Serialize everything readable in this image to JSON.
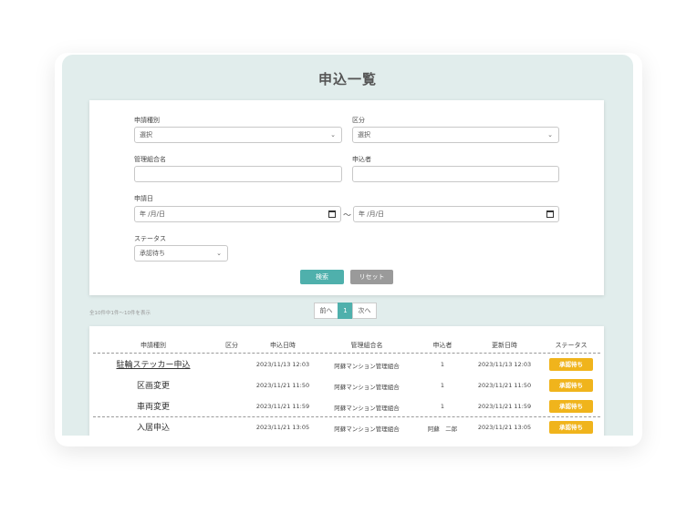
{
  "page": {
    "title": "申込一覧"
  },
  "form": {
    "type_label": "申請種別",
    "type_value": "選択",
    "category_label": "区分",
    "category_value": "選択",
    "association_label": "管理組合名",
    "association_value": "",
    "applicant_label": "申込者",
    "applicant_value": "",
    "date_label": "申請日",
    "date_from_placeholder": "年 /月/日",
    "date_to_placeholder": "年 /月/日",
    "date_separator": "～",
    "status_label": "ステータス",
    "status_value": "承認待ち",
    "search_button": "検索",
    "reset_button": "リセット"
  },
  "list": {
    "count_text": "全10件中1件～10件を表示",
    "pager": {
      "prev": "前へ",
      "current": "1",
      "next": "次へ"
    },
    "columns": [
      "申請種別",
      "区分",
      "申込日時",
      "管理組合名",
      "申込者",
      "更新日時",
      "ステータス"
    ],
    "rows": [
      {
        "type": "駐輪ステッカー申込",
        "category": "",
        "applied_at": "2023/11/13 12:03",
        "association": "阿蘇マンション管理組合",
        "applicant": "1",
        "updated_at": "2023/11/13 12:03",
        "status": "承認待ち"
      },
      {
        "type": "区画変更",
        "category": "",
        "applied_at": "2023/11/21 11:50",
        "association": "阿蘇マンション管理組合",
        "applicant": "1",
        "updated_at": "2023/11/21 11:50",
        "status": "承認待ち"
      },
      {
        "type": "車両変更",
        "category": "",
        "applied_at": "2023/11/21 11:59",
        "association": "阿蘇マンション管理組合",
        "applicant": "1",
        "updated_at": "2023/11/21 11:59",
        "status": "承認待ち"
      },
      {
        "type": "入居申込",
        "category": "",
        "applied_at": "2023/11/21 13:05",
        "association": "阿蘇マンション管理組合",
        "applicant": "阿蘇　二郎",
        "updated_at": "2023/11/21 13:05",
        "status": "承認待ち"
      }
    ]
  },
  "colors": {
    "accent": "#4fb0ac",
    "status_badge": "#f0b41c",
    "panel_bg": "#e1edec"
  }
}
